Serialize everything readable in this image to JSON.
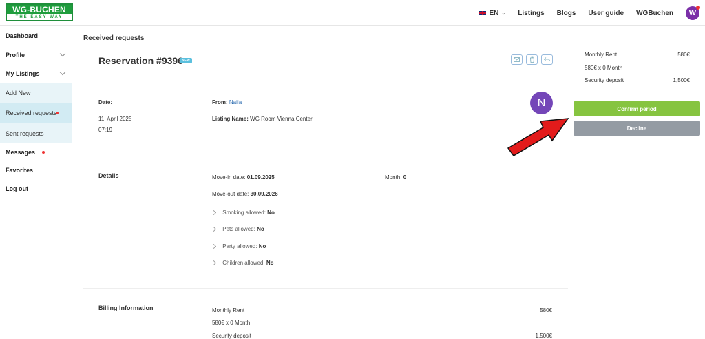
{
  "header": {
    "logo_top": "WG-BUCHEN",
    "logo_bottom": "THE EASY WAY",
    "lang": "EN",
    "nav": [
      "Listings",
      "Blogs",
      "User guide",
      "WGBuchen"
    ],
    "avatar_letter": "W"
  },
  "sidebar": {
    "dashboard": "Dashboard",
    "profile": "Profile",
    "my_listings": "My Listings",
    "add_new": "Add New",
    "received": "Received requests",
    "sent": "Sent requests",
    "messages": "Messages",
    "favorites": "Favorites",
    "logout": "Log out"
  },
  "page": {
    "title": "Received requests",
    "reservation": "Reservation #9396",
    "badge": "NEW"
  },
  "request": {
    "date_label": "Date:",
    "date": "11. April 2025",
    "time": "07:19",
    "from_label": "From:",
    "from": "Naila",
    "listing_label": "Listing Name:",
    "listing": "WG Room Vienna Center",
    "avatar_letter": "N"
  },
  "details": {
    "title": "Details",
    "movein_label": "Move-in date:",
    "movein": "01.09.2025",
    "moveout_label": "Move-out date:",
    "moveout": "30.09.2026",
    "month_label": "Month:",
    "month": "0",
    "smoking_label": "Smoking allowed:",
    "smoking": "No",
    "pets_label": "Pets allowed:",
    "pets": "No",
    "party_label": "Party allowed:",
    "party": "No",
    "children_label": "Children allowed:",
    "children": "No"
  },
  "billing": {
    "title": "Billing Information",
    "rent_label": "Monthly Rent",
    "rent": "580€",
    "calc": "580€ x 0 Month",
    "deposit_label": "Security deposit",
    "deposit": "1,500€"
  },
  "actions": {
    "confirm": "Confirm period",
    "decline": "Decline"
  },
  "colors": {
    "confirm": "#86c440",
    "decline": "#949ba3",
    "brand": "#1f9d3d",
    "avatar": "#7446b8"
  }
}
